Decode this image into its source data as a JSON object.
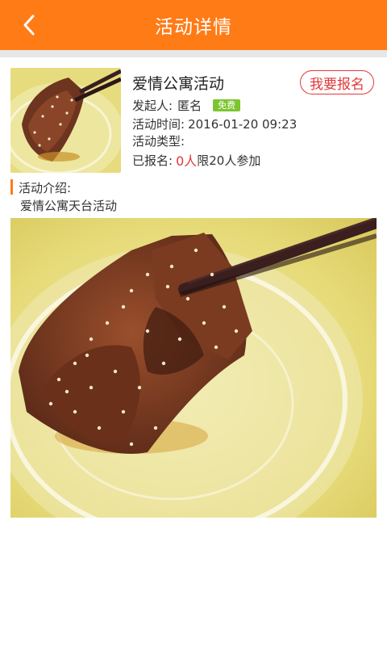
{
  "header": {
    "title": "活动详情",
    "bg_color": "#ff7b16"
  },
  "activity": {
    "name": "爱情公寓活动",
    "signup_label": "我要报名",
    "organizer_label": "发起人:",
    "organizer": "匿名",
    "price_tag": "免费",
    "time_label": "活动时间:",
    "time": "2016-01-20 09:23",
    "type_label": "活动类型:",
    "type": "",
    "registered_label": "已报名:",
    "registered_count": "0人",
    "limit_text": "限20人参加"
  },
  "intro": {
    "label": "活动介绍:",
    "text": "爱情公寓天台活动"
  },
  "icons": {
    "back": "chevron-left-icon"
  }
}
